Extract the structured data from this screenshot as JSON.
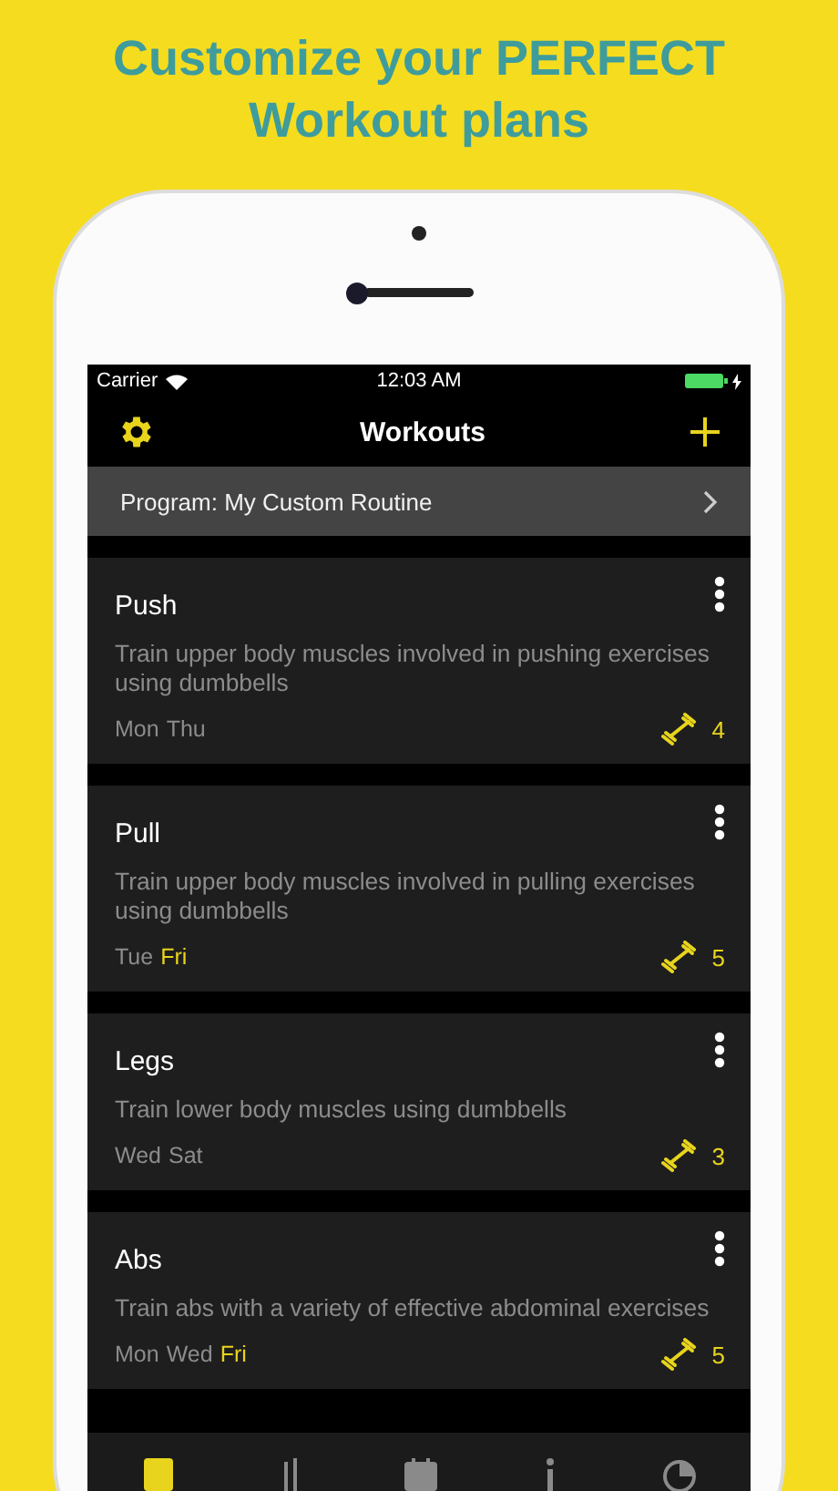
{
  "headline": "Customize your PERFECT Workout plans",
  "status_bar": {
    "carrier": "Carrier",
    "time": "12:03 AM",
    "charging": true
  },
  "nav": {
    "title": "Workouts"
  },
  "program": {
    "label": "Program: My Custom Routine"
  },
  "workouts": [
    {
      "name": "Push",
      "description": "Train upper body muscles involved in pushing exercises using dumbbells",
      "days": [
        {
          "label": "Mon",
          "highlighted": false
        },
        {
          "label": "Thu",
          "highlighted": false
        }
      ],
      "count": "4"
    },
    {
      "name": "Pull",
      "description": "Train upper body muscles involved in pulling exercises using dumbbells",
      "days": [
        {
          "label": "Tue",
          "highlighted": false
        },
        {
          "label": "Fri",
          "highlighted": true
        }
      ],
      "count": "5"
    },
    {
      "name": "Legs",
      "description": "Train lower body muscles using dumbbells",
      "days": [
        {
          "label": "Wed",
          "highlighted": false
        },
        {
          "label": "Sat",
          "highlighted": false
        }
      ],
      "count": "3"
    },
    {
      "name": "Abs",
      "description": "Train abs with a variety of effective abdominal exercises",
      "days": [
        {
          "label": "Mon",
          "highlighted": false
        },
        {
          "label": "Wed",
          "highlighted": false
        },
        {
          "label": "Fri",
          "highlighted": true
        }
      ],
      "count": "5"
    }
  ],
  "tab_bar": [
    {
      "kind": "list",
      "selected": true
    },
    {
      "kind": "chart",
      "selected": false
    },
    {
      "kind": "calendar",
      "selected": false
    },
    {
      "kind": "info",
      "selected": false
    },
    {
      "kind": "pie",
      "selected": false
    }
  ]
}
